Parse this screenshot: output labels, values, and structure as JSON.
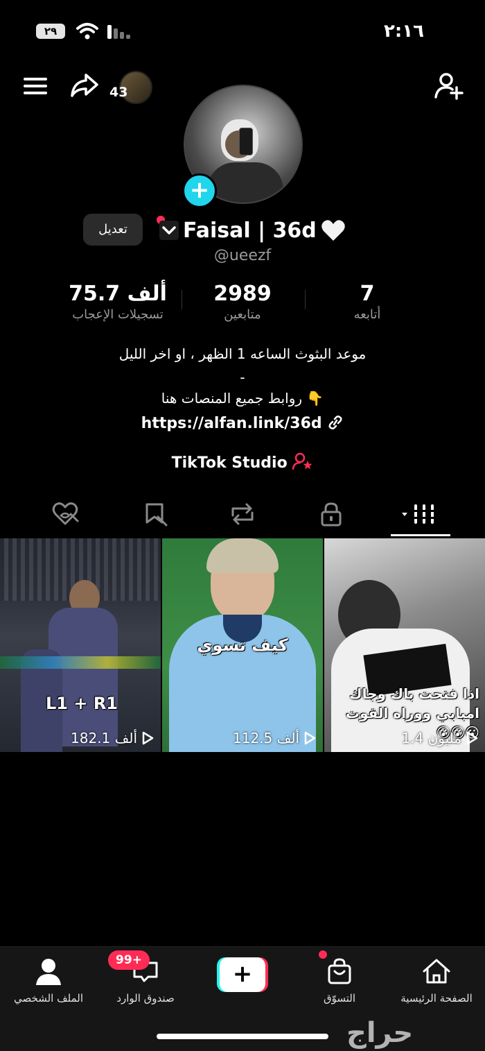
{
  "status_bar": {
    "time": "٢:١٦",
    "battery": "٢٩"
  },
  "top_bar": {
    "avatar_count": "43"
  },
  "profile": {
    "name": "Faisal | 36d",
    "handle": "@ueezf",
    "edit_label": "تعديل",
    "plus_symbol": "+"
  },
  "stats": [
    {
      "value": "7",
      "label": "أتابعه"
    },
    {
      "value": "2989",
      "label": "متابعين"
    },
    {
      "value": "75.7 ألف",
      "label": "تسجيلات الإعجاب"
    }
  ],
  "bio": {
    "line1": "موعد البثوث الساعه 1 الظهر ، او اخر الليل",
    "line2": "-",
    "line3": "روابط جميع المنصات هنا 👇",
    "link": "https://alfan.link/36d",
    "studio": "TikTok Studio"
  },
  "tabs": [
    "videos",
    "private",
    "reposts",
    "tagged",
    "liked"
  ],
  "videos": [
    {
      "caption": "اذا فتحت باك وجاك امبابي ووراه القوت 😮😮😮",
      "views": "1.4 مليون"
    },
    {
      "caption": "كيف تسوي",
      "views": "112.5 ألف"
    },
    {
      "caption": "L1 + R1",
      "views": "182.1 ألف"
    }
  ],
  "bottom_nav": {
    "home": "الصفحة الرئيسية",
    "shop": "التسوّق",
    "inbox": "صندوق الوارد",
    "inbox_badge": "99+",
    "profile": "الملف الشخصي",
    "create_symbol": "+"
  },
  "watermark": "حراج",
  "colors": {
    "accent_cyan": "#20d5ec",
    "accent_red": "#fe2c55"
  }
}
